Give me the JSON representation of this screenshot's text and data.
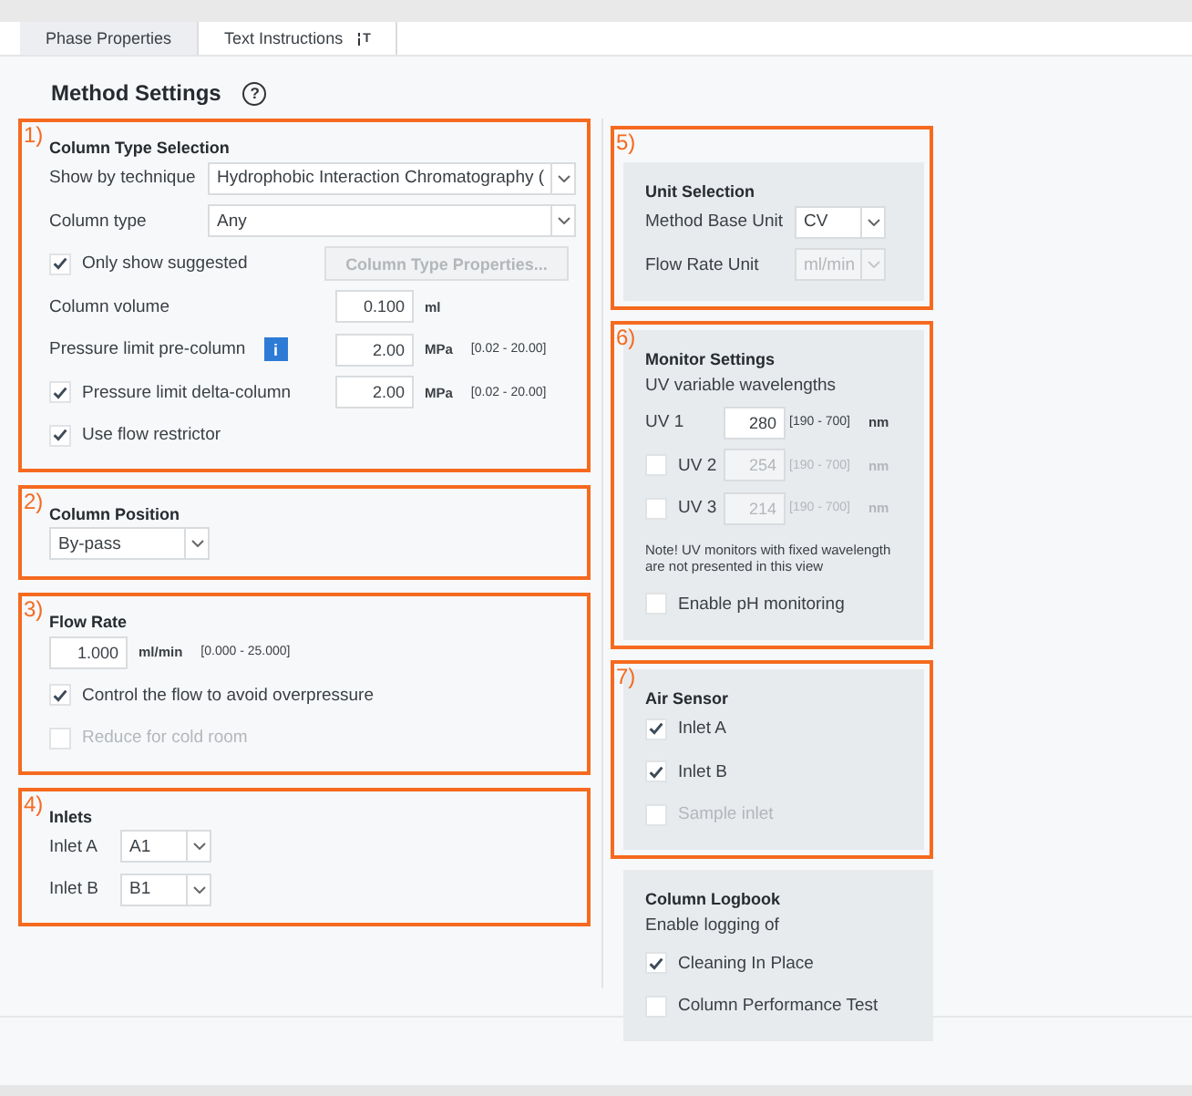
{
  "tabs": [
    {
      "label": "Phase Properties",
      "selected": true
    },
    {
      "label": "Text Instructions",
      "badge": "T",
      "selected": false
    }
  ],
  "title": "Method Settings",
  "help": "?",
  "left": [
    {
      "marker": "1)",
      "heading": "Column Type Selection",
      "rows": [
        {
          "kind": "combo",
          "label": "Show by technique",
          "value": "Hydrophobic Interaction Chromatography ("
        },
        {
          "kind": "combo",
          "label": "Column type",
          "value": "Any"
        },
        {
          "kind": "check",
          "label": "Only show suggested",
          "checked": true,
          "disabled": false,
          "button": {
            "label": "Column Type Properties...",
            "disabled": true
          }
        },
        {
          "kind": "number",
          "label": "Column volume",
          "value": "0.100",
          "unit": "ml"
        },
        {
          "kind": "number",
          "label": "Pressure limit pre-column",
          "info": "i",
          "value": "2.00",
          "unit": "MPa",
          "range": "[0.02 - 20.00]"
        },
        {
          "kind": "number",
          "label": "Pressure limit delta-column",
          "checked": true,
          "value": "2.00",
          "unit": "MPa",
          "range": "[0.02 - 20.00]"
        },
        {
          "kind": "check",
          "label": "Use flow restrictor",
          "checked": true,
          "disabled": false
        }
      ]
    },
    {
      "marker": "2)",
      "heading": "Column Position",
      "rows": [
        {
          "kind": "select",
          "value": "By-pass",
          "disabled": false
        }
      ]
    },
    {
      "marker": "3)",
      "heading": "Flow Rate",
      "rows": [
        {
          "kind": "number",
          "value": "1.000",
          "unit": "ml/min",
          "range": "[0.000 - 25.000]"
        },
        {
          "kind": "check",
          "label": "Control the flow to avoid overpressure",
          "checked": true,
          "disabled": false
        },
        {
          "kind": "check",
          "label": "Reduce for cold room",
          "checked": false,
          "disabled": true
        }
      ]
    },
    {
      "marker": "4)",
      "heading": "Inlets",
      "rows": [
        {
          "kind": "select",
          "label": "Inlet A",
          "value": "A1",
          "disabled": false
        },
        {
          "kind": "select",
          "label": "Inlet B",
          "value": "B1",
          "disabled": false
        }
      ]
    }
  ],
  "right": [
    {
      "marker": "5)",
      "heading": "Unit Selection",
      "rows": [
        {
          "kind": "select",
          "label": "Method Base Unit",
          "value": "CV",
          "disabled": false
        },
        {
          "kind": "select",
          "label": "Flow Rate Unit",
          "value": "ml/min",
          "disabled": true
        }
      ]
    },
    {
      "marker": "6)",
      "heading": "Monitor Settings",
      "rows": [
        {
          "kind": "text",
          "text": "UV variable wavelengths"
        },
        {
          "kind": "number",
          "label": "UV 1",
          "value": "280",
          "unit": "nm",
          "range": "[190 - 700]",
          "disabled": false
        },
        {
          "kind": "number",
          "label": "UV 2",
          "checked": false,
          "value": "254",
          "unit": "nm",
          "range": "[190 - 700]",
          "disabled": true
        },
        {
          "kind": "number",
          "label": "UV 3",
          "checked": false,
          "value": "214",
          "unit": "nm",
          "range": "[190 - 700]",
          "disabled": true
        },
        {
          "kind": "note",
          "text": "Note! UV monitors with fixed wavelength are not presented in this view"
        },
        {
          "kind": "check",
          "label": "Enable pH monitoring",
          "checked": false,
          "disabled": false
        }
      ]
    },
    {
      "marker": "7)",
      "heading": "Air Sensor",
      "rows": [
        {
          "kind": "check",
          "label": "Inlet A",
          "checked": true,
          "disabled": false
        },
        {
          "kind": "check",
          "label": "Inlet B",
          "checked": true,
          "disabled": false
        },
        {
          "kind": "check",
          "label": "Sample inlet",
          "checked": false,
          "disabled": true
        }
      ]
    },
    {
      "heading": "Column Logbook",
      "rows": [
        {
          "kind": "text",
          "text": "Enable logging of"
        },
        {
          "kind": "check",
          "label": "Cleaning In Place",
          "checked": true,
          "disabled": false
        },
        {
          "kind": "check",
          "label": "Column Performance Test",
          "checked": false,
          "disabled": false
        }
      ]
    }
  ]
}
